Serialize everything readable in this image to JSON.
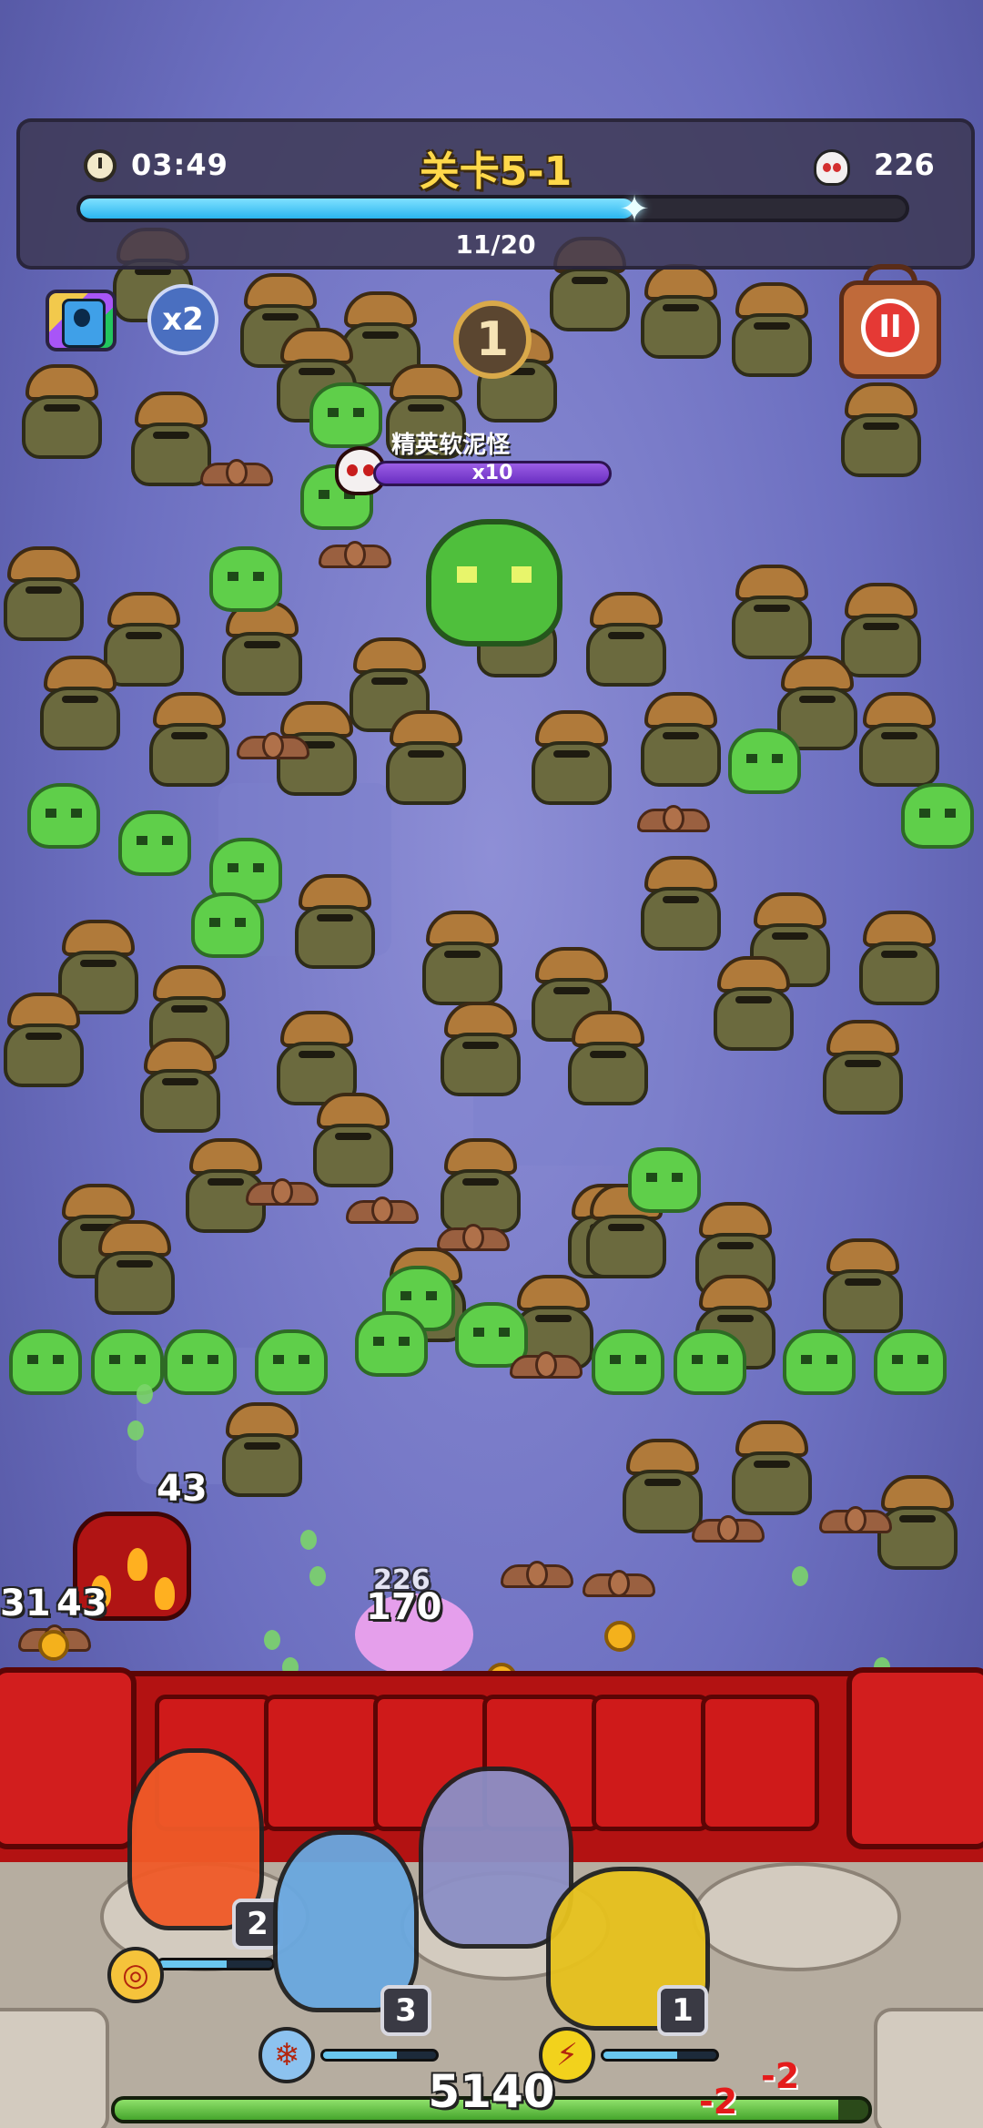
{
  "hud": {
    "timer": "03:49",
    "level_title": "关卡5-1",
    "kill_count": "226",
    "wave_text": "11/20",
    "wave_progress": 0.67
  },
  "buttons": {
    "speed_label": "x2",
    "pause_label": "II"
  },
  "center_badge": "1",
  "elite": {
    "name": "精英软泥怪",
    "multiplier": "x10"
  },
  "damage_numbers": [
    "43",
    "31",
    "43",
    "170",
    "226"
  ],
  "heroes": [
    {
      "name": "fire-hero",
      "level": "2",
      "hp": 0.6,
      "skill_icon": "fire-skill-icon",
      "color": "#f05a28"
    },
    {
      "name": "ice-knight-hero",
      "level": "3",
      "hp": 0.65,
      "skill_icon": "ice-crystal-skill-icon",
      "color": "#6aa8e0"
    },
    {
      "name": "dark-elf-hero",
      "level": "",
      "hp": 0.0,
      "skill_icon": "",
      "color": "#8c8fc6"
    },
    {
      "name": "thunder-warrior-hero",
      "level": "1",
      "hp": 0.65,
      "skill_icon": "lightning-skill-icon",
      "color": "#e7c21d"
    }
  ],
  "base": {
    "hp_text": "5140",
    "hp": 0.96,
    "damage_text": [
      "-2",
      "-2"
    ]
  },
  "colors": {
    "progress": "#2bb6ef",
    "wall": "#b31212",
    "elite_bar": "#7a3fd0",
    "base_hp": "#45a52c"
  }
}
